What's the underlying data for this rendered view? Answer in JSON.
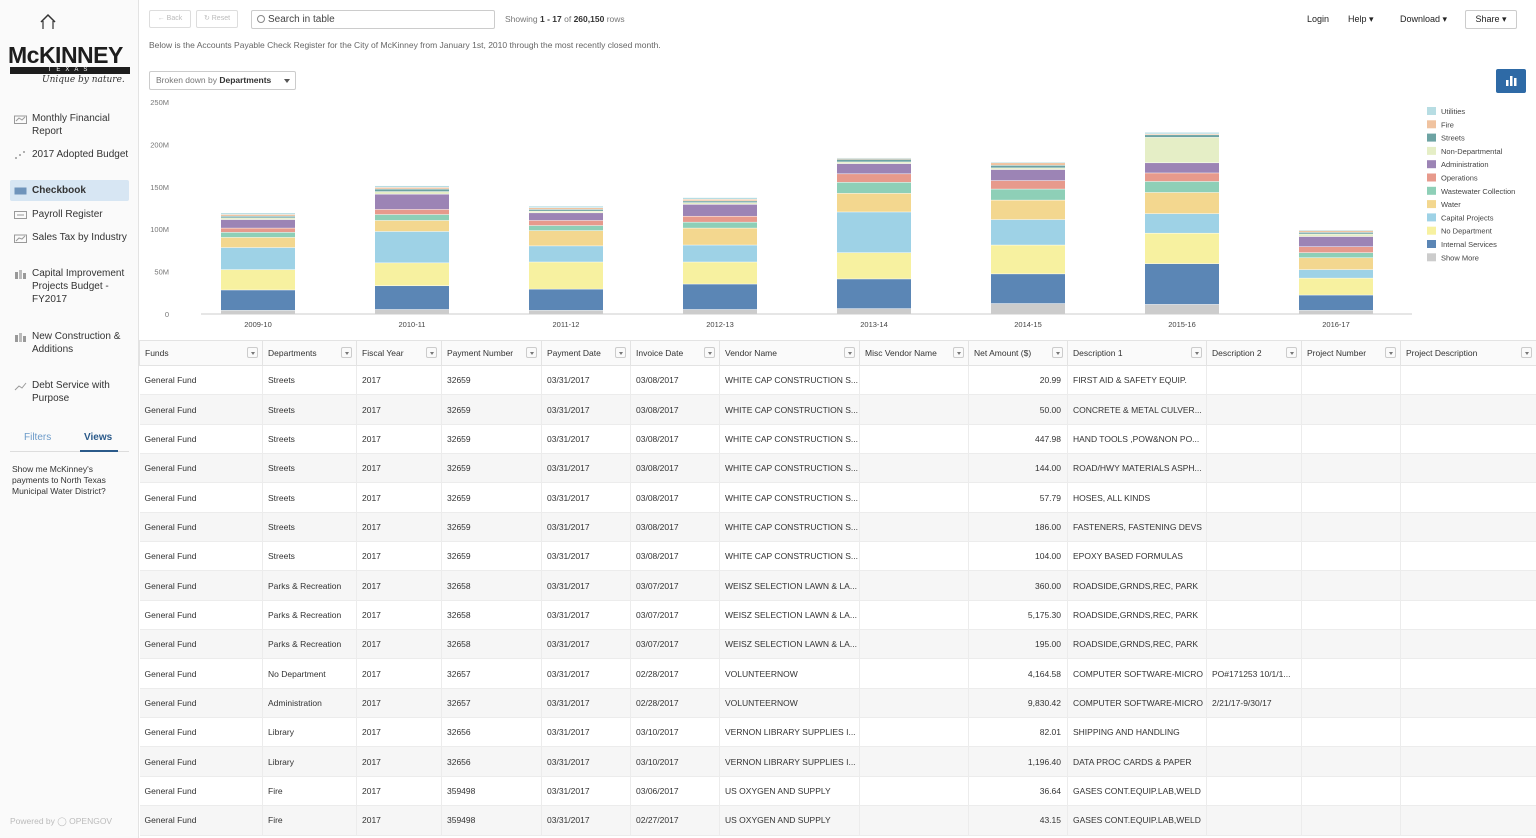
{
  "sidebar": {
    "logo": {
      "name": "McKINNEY",
      "sub": "TEXAS",
      "tagline": "Unique by nature."
    },
    "items": [
      {
        "label": "Monthly Financial Report",
        "icon": "report-icon"
      },
      {
        "label": "2017 Adopted Budget",
        "icon": "scatter-icon"
      },
      {
        "label": "Checkbook",
        "icon": "checkbook-icon",
        "active": true
      },
      {
        "label": "Payroll Register",
        "icon": "payroll-icon"
      },
      {
        "label": "Sales Tax by Industry",
        "icon": "chart-icon"
      },
      {
        "label": "Capital Improvement Projects Budget - FY2017",
        "icon": "bar-icon"
      },
      {
        "label": "New Construction & Additions",
        "icon": "bar-icon"
      },
      {
        "label": "Debt Service with Purpose",
        "icon": "debt-icon"
      }
    ],
    "tabs": {
      "filters": "Filters",
      "views": "Views"
    },
    "view_link": "Show me McKinney's payments to North Texas Municipal Water District?",
    "powered_by": "Powered by ◯ OPENGOV"
  },
  "topbar": {
    "back": "← Back",
    "reset": "↻ Reset",
    "search_placeholder": "Search in table",
    "showing_prefix": "Showing",
    "showing_range": "1 - 17",
    "showing_mid": "of",
    "showing_total": "260,150",
    "showing_suffix": "rows",
    "login": "Login",
    "help": "Help ▾",
    "download": "Download ▾",
    "share": "Share ▾",
    "description": "Below is the Accounts Payable Check Register for the City of McKinney from January 1st, 2010 through the most recently closed month."
  },
  "breakdown": {
    "prefix": "Broken down by",
    "value": "Departments"
  },
  "chart_data": {
    "type": "bar",
    "stacked": true,
    "categories": [
      "2009-10",
      "2010-11",
      "2011-12",
      "2012-13",
      "2013-14",
      "2014-15",
      "2015-16",
      "2016-17"
    ],
    "y_ticks": [
      "0",
      "50M",
      "100M",
      "150M",
      "200M",
      "250M"
    ],
    "ylim": [
      0,
      250
    ],
    "legend_position": "right",
    "series": [
      {
        "name": "Show More",
        "color": "#cccccc",
        "values": [
          4,
          5,
          4,
          5,
          6,
          12,
          11,
          4
        ]
      },
      {
        "name": "Internal Services",
        "color": "#5b86b5",
        "values": [
          24,
          28,
          25,
          30,
          35,
          35,
          48,
          18
        ]
      },
      {
        "name": "No Department",
        "color": "#f7f1a0",
        "values": [
          24,
          27,
          32,
          26,
          31,
          34,
          36,
          20
        ]
      },
      {
        "name": "Capital Projects",
        "color": "#9ed2e6",
        "values": [
          26,
          37,
          19,
          20,
          48,
          30,
          23,
          10
        ]
      },
      {
        "name": "Water",
        "color": "#f3d78f",
        "values": [
          12,
          13,
          18,
          20,
          22,
          23,
          25,
          14
        ]
      },
      {
        "name": "Wastewater Collection",
        "color": "#8ecfb7",
        "values": [
          6,
          7,
          6,
          7,
          13,
          13,
          13,
          6
        ]
      },
      {
        "name": "Operations",
        "color": "#e79a8c",
        "values": [
          5,
          6,
          6,
          7,
          10,
          10,
          10,
          7
        ]
      },
      {
        "name": "Administration",
        "color": "#9c84b5",
        "values": [
          10,
          18,
          9,
          14,
          12,
          13,
          12,
          12
        ]
      },
      {
        "name": "Non-Departmental",
        "color": "#e5eec6",
        "values": [
          2,
          3,
          2,
          2,
          2,
          2,
          30,
          3
        ]
      },
      {
        "name": "Streets",
        "color": "#6da3a3",
        "values": [
          2,
          3,
          2,
          2,
          3,
          3,
          3,
          2
        ]
      },
      {
        "name": "Fire",
        "color": "#f0c3a0",
        "values": [
          2,
          2,
          2,
          2,
          1,
          3,
          1,
          2
        ]
      },
      {
        "name": "Utilities",
        "color": "#b7dde3",
        "values": [
          2,
          2,
          2,
          2,
          1,
          1,
          2,
          1
        ]
      }
    ]
  },
  "table": {
    "columns": [
      "Funds",
      "Departments",
      "Fiscal Year",
      "Payment Number",
      "Payment Date",
      "Invoice Date",
      "Vendor Name",
      "Misc Vendor Name",
      "Net Amount ($)",
      "Description 1",
      "Description 2",
      "Project Number",
      "Project Description"
    ],
    "rows": [
      [
        "General Fund",
        "Streets",
        "2017",
        "32659",
        "03/31/2017",
        "03/08/2017",
        "WHITE CAP CONSTRUCTION S...",
        "",
        "20.99",
        "FIRST AID & SAFETY EQUIP.",
        "",
        "",
        ""
      ],
      [
        "General Fund",
        "Streets",
        "2017",
        "32659",
        "03/31/2017",
        "03/08/2017",
        "WHITE CAP CONSTRUCTION S...",
        "",
        "50.00",
        "CONCRETE & METAL CULVER...",
        "",
        "",
        ""
      ],
      [
        "General Fund",
        "Streets",
        "2017",
        "32659",
        "03/31/2017",
        "03/08/2017",
        "WHITE CAP CONSTRUCTION S...",
        "",
        "447.98",
        "HAND TOOLS ,POW&NON PO...",
        "",
        "",
        ""
      ],
      [
        "General Fund",
        "Streets",
        "2017",
        "32659",
        "03/31/2017",
        "03/08/2017",
        "WHITE CAP CONSTRUCTION S...",
        "",
        "144.00",
        "ROAD/HWY MATERIALS ASPH...",
        "",
        "",
        ""
      ],
      [
        "General Fund",
        "Streets",
        "2017",
        "32659",
        "03/31/2017",
        "03/08/2017",
        "WHITE CAP CONSTRUCTION S...",
        "",
        "57.79",
        "HOSES, ALL KINDS",
        "",
        "",
        ""
      ],
      [
        "General Fund",
        "Streets",
        "2017",
        "32659",
        "03/31/2017",
        "03/08/2017",
        "WHITE CAP CONSTRUCTION S...",
        "",
        "186.00",
        "FASTENERS, FASTENING DEVS",
        "",
        "",
        ""
      ],
      [
        "General Fund",
        "Streets",
        "2017",
        "32659",
        "03/31/2017",
        "03/08/2017",
        "WHITE CAP CONSTRUCTION S...",
        "",
        "104.00",
        "EPOXY BASED FORMULAS",
        "",
        "",
        ""
      ],
      [
        "General Fund",
        "Parks & Recreation",
        "2017",
        "32658",
        "03/31/2017",
        "03/07/2017",
        "WEISZ SELECTION LAWN & LA...",
        "",
        "360.00",
        "ROADSIDE,GRNDS,REC, PARK",
        "",
        "",
        ""
      ],
      [
        "General Fund",
        "Parks & Recreation",
        "2017",
        "32658",
        "03/31/2017",
        "03/07/2017",
        "WEISZ SELECTION LAWN & LA...",
        "",
        "5,175.30",
        "ROADSIDE,GRNDS,REC, PARK",
        "",
        "",
        ""
      ],
      [
        "General Fund",
        "Parks & Recreation",
        "2017",
        "32658",
        "03/31/2017",
        "03/07/2017",
        "WEISZ SELECTION LAWN & LA...",
        "",
        "195.00",
        "ROADSIDE,GRNDS,REC, PARK",
        "",
        "",
        ""
      ],
      [
        "General Fund",
        "No Department",
        "2017",
        "32657",
        "03/31/2017",
        "02/28/2017",
        "VOLUNTEERNOW",
        "",
        "4,164.58",
        "COMPUTER SOFTWARE-MICRO",
        "PO#171253 10/1/1...",
        "",
        ""
      ],
      [
        "General Fund",
        "Administration",
        "2017",
        "32657",
        "03/31/2017",
        "02/28/2017",
        "VOLUNTEERNOW",
        "",
        "9,830.42",
        "COMPUTER SOFTWARE-MICRO",
        "2/21/17-9/30/17",
        "",
        ""
      ],
      [
        "General Fund",
        "Library",
        "2017",
        "32656",
        "03/31/2017",
        "03/10/2017",
        "VERNON LIBRARY SUPPLIES I...",
        "",
        "82.01",
        "SHIPPING AND HANDLING",
        "",
        "",
        ""
      ],
      [
        "General Fund",
        "Library",
        "2017",
        "32656",
        "03/31/2017",
        "03/10/2017",
        "VERNON LIBRARY SUPPLIES I...",
        "",
        "1,196.40",
        "DATA PROC CARDS & PAPER",
        "",
        "",
        ""
      ],
      [
        "General Fund",
        "Fire",
        "2017",
        "359498",
        "03/31/2017",
        "03/06/2017",
        "US OXYGEN AND SUPPLY",
        "",
        "36.64",
        "GASES CONT.EQUIP.LAB,WELD",
        "",
        "",
        ""
      ],
      [
        "General Fund",
        "Fire",
        "2017",
        "359498",
        "03/31/2017",
        "02/27/2017",
        "US OXYGEN AND SUPPLY",
        "",
        "43.15",
        "GASES CONT.EQUIP.LAB,WELD",
        "",
        "",
        ""
      ]
    ]
  }
}
